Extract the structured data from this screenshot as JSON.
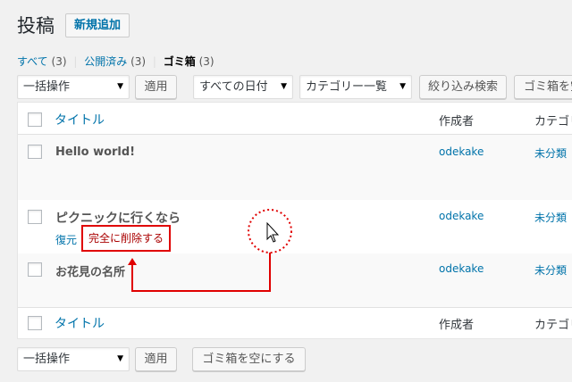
{
  "header": {
    "title": "投稿",
    "add_new": "新規追加"
  },
  "filters": {
    "all": {
      "label": "すべて",
      "count": "(3)"
    },
    "published": {
      "label": "公開済み",
      "count": "(3)"
    },
    "trash": {
      "label": "ゴミ箱",
      "count": "(3)"
    },
    "separator": "|"
  },
  "toolbar_top": {
    "bulk_select": "一括操作",
    "apply": "適用",
    "date_select": "すべての日付",
    "category_select": "カテゴリー一覧",
    "filter_button": "絞り込み検索",
    "empty_trash": "ゴミ箱を空にする"
  },
  "table": {
    "columns": {
      "title": "タイトル",
      "author": "作成者",
      "categories": "カテゴリー"
    },
    "rows": [
      {
        "title": "Hello world!",
        "author": "odekake",
        "category": "未分類"
      },
      {
        "title": "ピクニックに行くなら",
        "author": "odekake",
        "category": "未分類",
        "restore": "復元",
        "delete": "完全に削除する"
      },
      {
        "title": "お花見の名所",
        "author": "odekake",
        "category": "未分類"
      }
    ]
  },
  "toolbar_bottom": {
    "bulk_select": "一括操作",
    "apply": "適用",
    "empty_trash": "ゴミ箱を空にする"
  },
  "colors": {
    "link": "#0073aa",
    "annotation": "#e00000",
    "delete": "#a00"
  },
  "icons": {
    "caret": "caret-down-icon",
    "cursor": "mouse-pointer-icon"
  }
}
